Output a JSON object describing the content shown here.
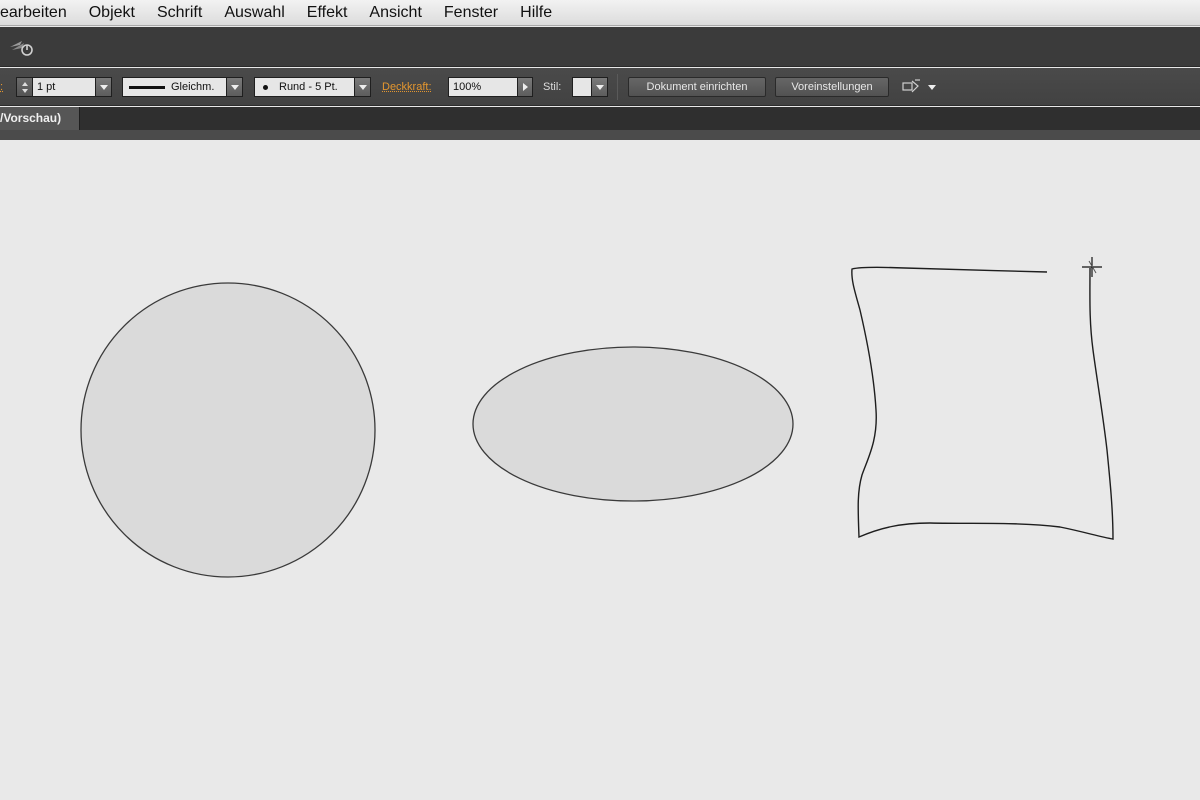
{
  "menu": {
    "items": [
      "earbeiten",
      "Objekt",
      "Schrift",
      "Auswahl",
      "Effekt",
      "Ansicht",
      "Fenster",
      "Hilfe"
    ]
  },
  "appbar": {
    "icon": "sync-settings-icon"
  },
  "control_bar": {
    "stroke_label_fragment": ":",
    "stroke_weight": "1 pt",
    "stroke_profile": "Gleichm.",
    "brush": "Rund - 5 Pt.",
    "opacity_label": "Deckkraft:",
    "opacity_value": "100%",
    "style_label": "Stil:",
    "document_setup_button": "Dokument einrichten",
    "preferences_button": "Voreinstellungen",
    "accent_color": "#e3962f"
  },
  "document_tab": {
    "label": "/Vorschau)"
  },
  "canvas": {
    "shapes": [
      "circle",
      "ellipse",
      "freehand-rectangle"
    ],
    "fill_color": "#d9d9d9",
    "stroke_color": "#3a3a3a",
    "background_color": "#e9e9e9"
  }
}
